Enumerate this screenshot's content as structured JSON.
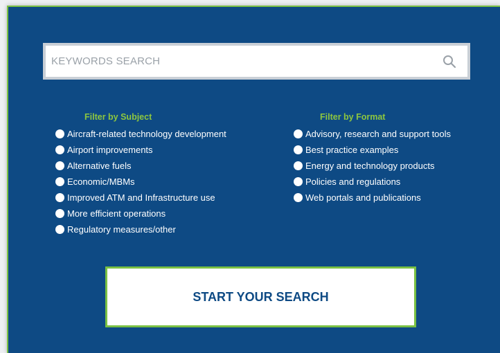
{
  "search": {
    "placeholder": "KEYWORDS SEARCH",
    "value": "",
    "icon": "search-icon"
  },
  "subject_filter": {
    "heading": "Filter by Subject",
    "items": [
      "Aircraft-related technology development",
      "Airport improvements",
      "Alternative fuels",
      "Economic/MBMs",
      "Improved ATM and Infrastructure use",
      "More efficient operations",
      "Regulatory measures/other"
    ]
  },
  "format_filter": {
    "heading": "Filter by Format",
    "items": [
      "Advisory, research and support tools",
      "Best practice examples",
      "Energy and technology products",
      "Policies and regulations",
      "Web portals and publications"
    ]
  },
  "start_button": {
    "label": "START YOUR SEARCH"
  },
  "colors": {
    "panel_bg": "#0e4a84",
    "accent_green": "#8dc63f",
    "border_green": "#7ac143",
    "text_white": "#ffffff"
  }
}
